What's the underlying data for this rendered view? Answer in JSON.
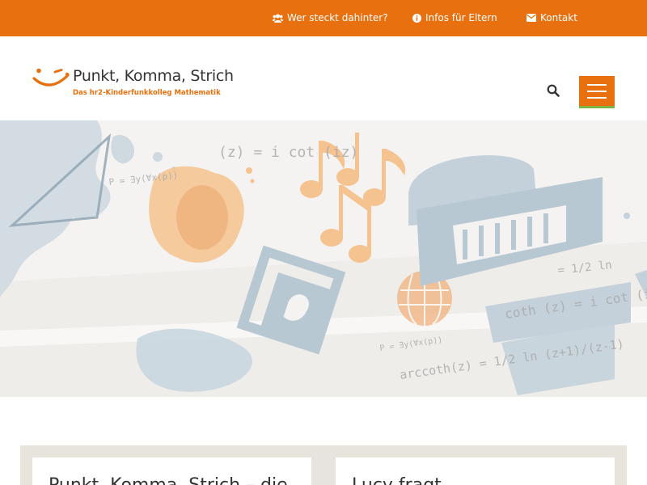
{
  "topbar": {
    "links": [
      {
        "label": "Wer steckt dahinter?",
        "icon": "users-icon"
      },
      {
        "label": "Infos für Eltern",
        "icon": "info-circle-icon"
      },
      {
        "label": "Kontakt",
        "icon": "envelope-icon"
      }
    ]
  },
  "header": {
    "logo_title": "Punkt, Komma, Strich",
    "logo_subtitle": "Das hr2-Kinderfunkkolleg Mathematik",
    "search_icon": "search-icon",
    "menu_icon": "hamburger-menu-icon"
  },
  "hero": {
    "formula_1": "(z) = i cot (iz)",
    "formula_2": "coth (z) = i cot (iz)",
    "formula_3": "arccoth(z) = 1/2 ln (z+1)/(z-1)",
    "formula_4": "= 1/2 ln",
    "formula_5": "P = ∃y(∀x(p))"
  },
  "cards": [
    {
      "title": "Punkt, Komma, Strich – die"
    },
    {
      "title": "Lucy fragt"
    }
  ],
  "colors": {
    "accent": "#e8700e",
    "green": "#7cb342",
    "illustration_blue": "#c9d6df",
    "illustration_orange": "#f5c38f"
  }
}
